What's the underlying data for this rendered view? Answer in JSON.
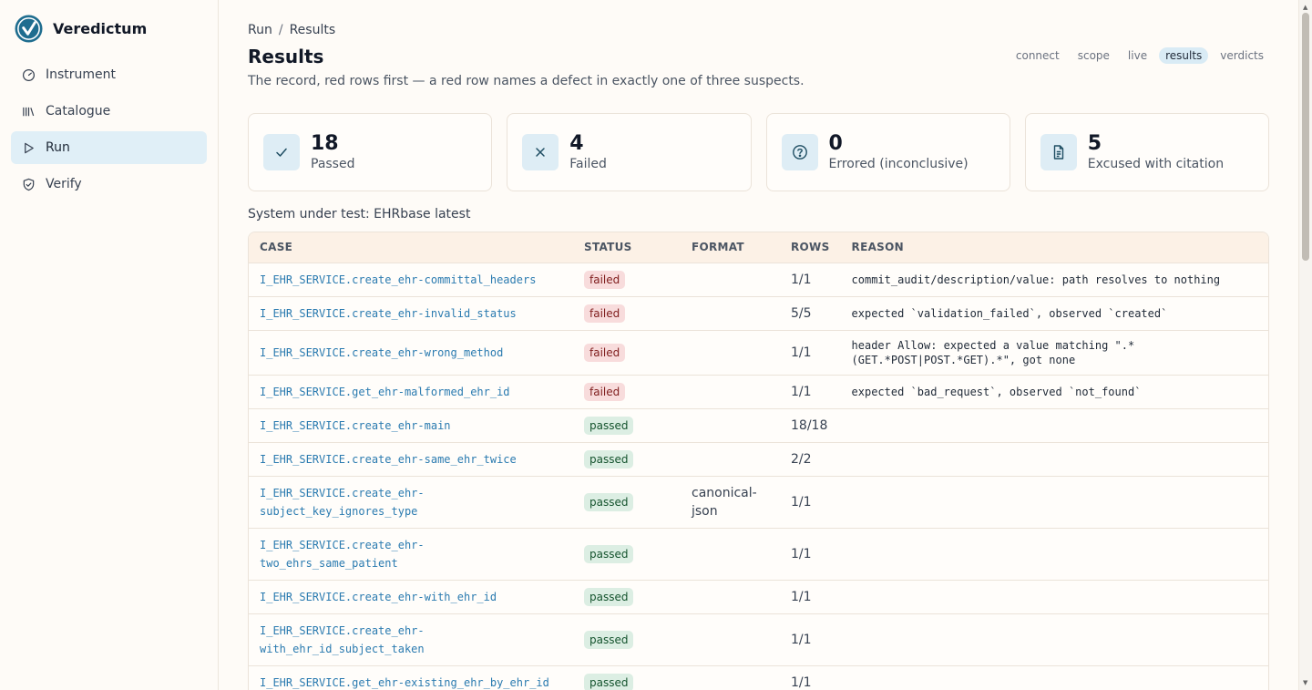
{
  "app": {
    "name": "Veredictum",
    "accent": "#1f6d8f"
  },
  "sidebar": {
    "items": [
      {
        "label": "Instrument",
        "icon": "gauge-icon"
      },
      {
        "label": "Catalogue",
        "icon": "library-icon"
      },
      {
        "label": "Run",
        "icon": "play-icon",
        "active": true
      },
      {
        "label": "Verify",
        "icon": "shield-check-icon"
      }
    ]
  },
  "breadcrumb": {
    "parent": "Run",
    "separator": "/",
    "current": "Results"
  },
  "page": {
    "title": "Results",
    "subtitle": "The record, red rows first — a red row names a defect in exactly one of three suspects."
  },
  "tabs": [
    {
      "label": "connect"
    },
    {
      "label": "scope"
    },
    {
      "label": "live"
    },
    {
      "label": "results",
      "active": true
    },
    {
      "label": "verdicts"
    }
  ],
  "stats": [
    {
      "value": "18",
      "label": "Passed",
      "icon": "check-icon"
    },
    {
      "value": "4",
      "label": "Failed",
      "icon": "x-icon"
    },
    {
      "value": "0",
      "label": "Errored (inconclusive)",
      "icon": "question-circle-icon"
    },
    {
      "value": "5",
      "label": "Excused with citation",
      "icon": "document-icon"
    }
  ],
  "sut": "System under test: EHRbase latest",
  "table": {
    "columns": [
      "CASE",
      "STATUS",
      "FORMAT",
      "ROWS",
      "REASON"
    ],
    "rows": [
      {
        "case": "I_EHR_SERVICE.create_ehr-committal_headers",
        "status": "failed",
        "format": "",
        "rows": "1/1",
        "reason": "commit_audit/description/value: path resolves to nothing"
      },
      {
        "case": "I_EHR_SERVICE.create_ehr-invalid_status",
        "status": "failed",
        "format": "",
        "rows": "5/5",
        "reason": "expected `validation_failed`, observed `created`"
      },
      {
        "case": "I_EHR_SERVICE.create_ehr-wrong_method",
        "status": "failed",
        "format": "",
        "rows": "1/1",
        "reason": "header Allow: expected a value matching \".*\n(GET.*POST|POST.*GET).*\", got none"
      },
      {
        "case": "I_EHR_SERVICE.get_ehr-malformed_ehr_id",
        "status": "failed",
        "format": "",
        "rows": "1/1",
        "reason": "expected `bad_request`, observed `not_found`"
      },
      {
        "case": "I_EHR_SERVICE.create_ehr-main",
        "status": "passed",
        "format": "",
        "rows": "18/18",
        "reason": ""
      },
      {
        "case": "I_EHR_SERVICE.create_ehr-same_ehr_twice",
        "status": "passed",
        "format": "",
        "rows": "2/2",
        "reason": ""
      },
      {
        "case": "I_EHR_SERVICE.create_ehr-\nsubject_key_ignores_type",
        "status": "passed",
        "format": "canonical-\njson",
        "rows": "1/1",
        "reason": ""
      },
      {
        "case": "I_EHR_SERVICE.create_ehr-\ntwo_ehrs_same_patient",
        "status": "passed",
        "format": "",
        "rows": "1/1",
        "reason": ""
      },
      {
        "case": "I_EHR_SERVICE.create_ehr-with_ehr_id",
        "status": "passed",
        "format": "",
        "rows": "1/1",
        "reason": ""
      },
      {
        "case": "I_EHR_SERVICE.create_ehr-\nwith_ehr_id_subject_taken",
        "status": "passed",
        "format": "",
        "rows": "1/1",
        "reason": ""
      },
      {
        "case": "I_EHR_SERVICE.get_ehr-existing_ehr_by_ehr_id",
        "status": "passed",
        "format": "",
        "rows": "1/1",
        "reason": ""
      }
    ]
  },
  "colors": {
    "failed_bg": "#f8dcdc",
    "passed_bg": "#dceee3",
    "active_nav": "#e0eff7",
    "link": "#2b7bb0"
  }
}
